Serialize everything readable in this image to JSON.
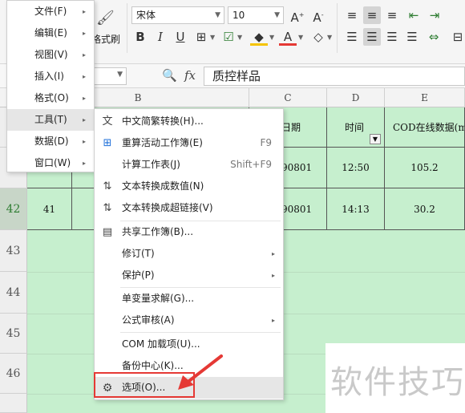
{
  "toolbar": {
    "format_painter_label": "格式刷",
    "font_name": "宋体",
    "font_size": "10"
  },
  "formula": {
    "fx_label": "fx",
    "value": "质控样品"
  },
  "columns": [
    "B",
    "C",
    "D",
    "E"
  ],
  "header_row": {
    "c": "日期",
    "d": "时间",
    "e": "COD在线数据(m"
  },
  "rows": [
    {
      "num": "",
      "a": "",
      "c": "90801",
      "d": "12:50",
      "e": "105.2"
    },
    {
      "num": "42",
      "a": "41",
      "c": "90801",
      "d": "14:13",
      "e": "30.2"
    }
  ],
  "empty_rows": [
    "43",
    "44",
    "45",
    "46"
  ],
  "main_menu": [
    {
      "label": "文件(F)"
    },
    {
      "label": "编辑(E)"
    },
    {
      "label": "视图(V)"
    },
    {
      "label": "插入(I)"
    },
    {
      "label": "格式(O)"
    },
    {
      "label": "工具(T)"
    },
    {
      "label": "数据(D)"
    },
    {
      "label": "窗口(W)"
    }
  ],
  "tools_menu": [
    {
      "label": "中文简繁转换(H)...",
      "shortcut": "",
      "icon": "traditional-simplified-icon"
    },
    {
      "label": "重算活动工作簿(E)",
      "shortcut": "F9",
      "icon": "recalc-workbook-icon"
    },
    {
      "label": "计算工作表(J)",
      "shortcut": "Shift+F9",
      "icon": ""
    },
    {
      "label": "文本转换成数值(N)",
      "shortcut": "",
      "icon": "text-to-number-icon"
    },
    {
      "label": "文本转换成超链接(V)",
      "shortcut": "",
      "icon": "text-to-hyperlink-icon"
    },
    {
      "label": "共享工作簿(B)...",
      "shortcut": "",
      "icon": "share-workbook-icon"
    },
    {
      "label": "修订(T)",
      "shortcut": "",
      "icon": ""
    },
    {
      "label": "保护(P)",
      "shortcut": "",
      "icon": ""
    },
    {
      "label": "单变量求解(G)...",
      "shortcut": "",
      "icon": ""
    },
    {
      "label": "公式审核(A)",
      "shortcut": "",
      "icon": ""
    },
    {
      "label": "COM 加载项(U)...",
      "shortcut": "",
      "icon": ""
    },
    {
      "label": "备份中心(K)...",
      "shortcut": "",
      "icon": ""
    },
    {
      "label": "选项(O)...",
      "shortcut": "",
      "icon": "gear-icon"
    }
  ],
  "watermark": "软件技巧",
  "colors": {
    "grid_green": "#c6efce",
    "highlight_red": "#e53935"
  }
}
